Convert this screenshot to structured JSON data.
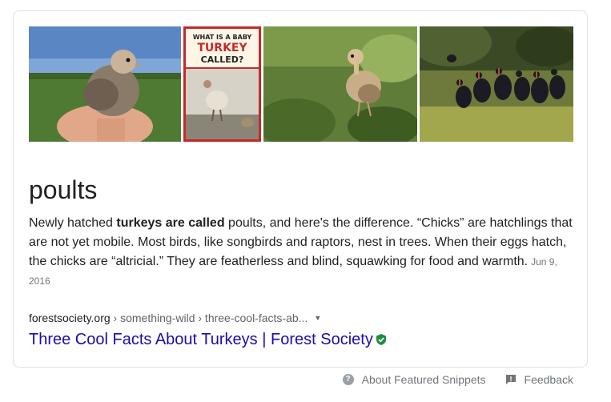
{
  "images": [
    {
      "name": "poult-in-hand",
      "alt": "turkey poult held in hand"
    },
    {
      "name": "baby-turkey-poster",
      "poster_lines": [
        "WHAT IS A BABY",
        "TURKEY",
        "CALLED?"
      ]
    },
    {
      "name": "poult-in-grass",
      "alt": "turkey poult in grass"
    },
    {
      "name": "wild-turkeys-flock",
      "alt": "flock of wild turkeys"
    }
  ],
  "answer": {
    "title": "poults"
  },
  "snippet": {
    "prefix": "Newly hatched ",
    "bold": "turkeys are called",
    "suffix": " poults, and here's the difference. “Chicks” are hatchlings that are not yet mobile. Most birds, like songbirds and raptors, nest in trees. When their eggs hatch, the chicks are “altricial.” They are featherless and blind, squawking for food and warmth.",
    "date": "Jun 9, 2016"
  },
  "source": {
    "domain": "forestsociety.org",
    "path": " › something-wild › three-cool-facts-ab...",
    "title": "Three Cool Facts About Turkeys | Forest Society"
  },
  "footer": {
    "about_label": "About Featured Snippets",
    "feedback_label": "Feedback"
  },
  "colors": {
    "link": "#1a0dab",
    "verified": "#1e8e3e",
    "poster_red": "#c62828"
  }
}
